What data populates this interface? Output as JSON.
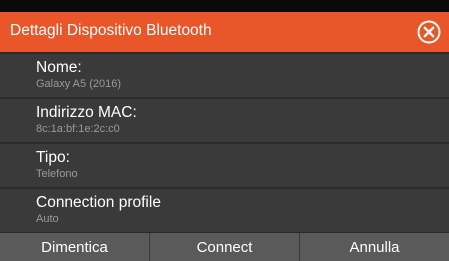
{
  "dialog": {
    "title": "Dettagli Dispositivo Bluetooth",
    "close_icon": "close-circle-x-icon",
    "accent_color": "#e8562a"
  },
  "fields": [
    {
      "label": "Nome:",
      "value": "Galaxy A5 (2016)"
    },
    {
      "label": "Indirizzo MAC:",
      "value": "8c:1a:bf:1e:2c:c0"
    },
    {
      "label": "Tipo:",
      "value": "Telefono"
    },
    {
      "label": "Connection profile",
      "value": "Auto"
    }
  ],
  "buttons": {
    "forget": "Dimentica",
    "connect": "Connect",
    "cancel": "Annulla"
  }
}
